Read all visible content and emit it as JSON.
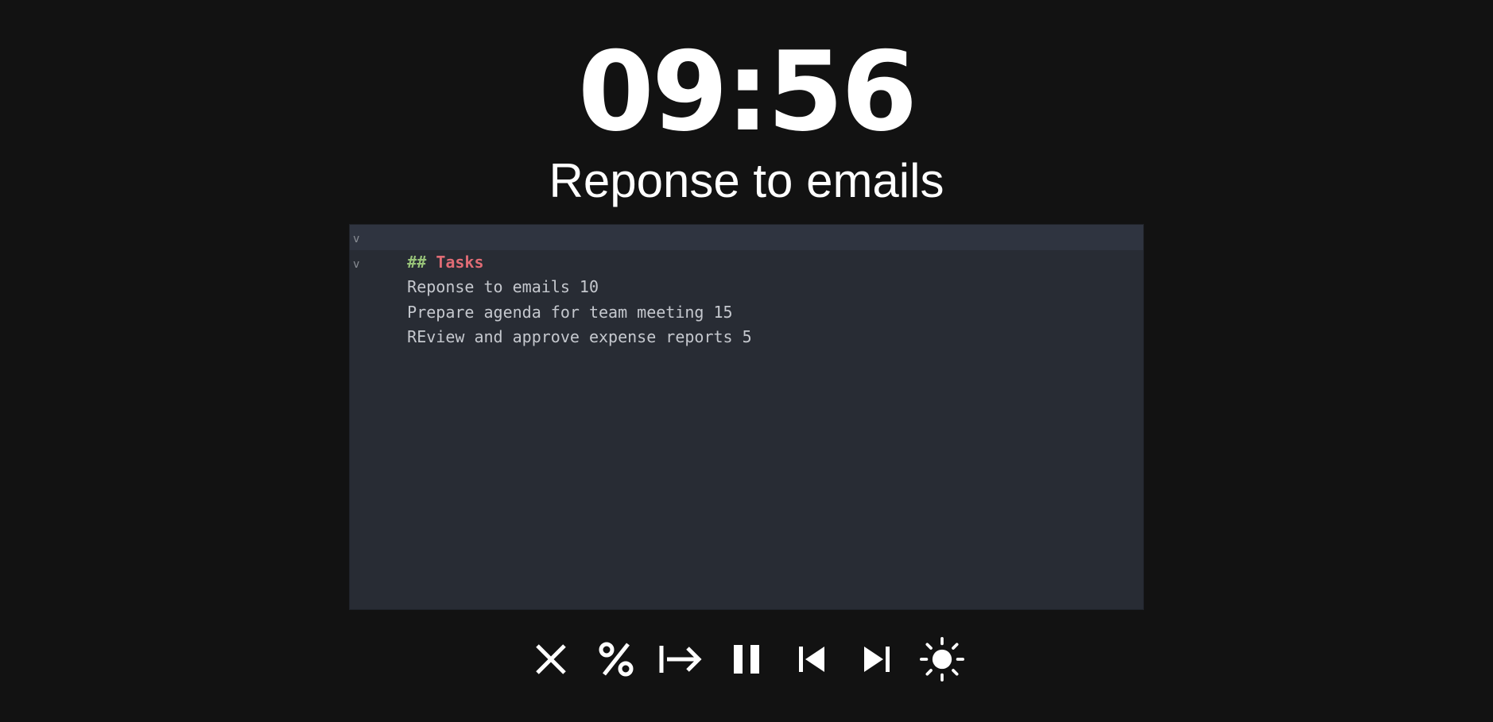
{
  "timer": {
    "display": "09:56"
  },
  "current_task": {
    "label": "Reponse to emails"
  },
  "editor": {
    "heading_marker": "##",
    "heading_text": "Tasks",
    "fold_glyph": "v",
    "lines": [
      "Reponse to emails 10",
      "Prepare agenda for team meeting 15",
      "REview and approve expense reports 5"
    ]
  },
  "controls": [
    {
      "name": "close",
      "icon": "close-icon"
    },
    {
      "name": "percent",
      "icon": "percent-icon"
    },
    {
      "name": "skip-to-end",
      "icon": "arrow-right-bar-icon"
    },
    {
      "name": "pause",
      "icon": "pause-icon"
    },
    {
      "name": "previous",
      "icon": "skip-previous-icon"
    },
    {
      "name": "next",
      "icon": "skip-next-icon"
    },
    {
      "name": "theme",
      "icon": "sun-icon"
    }
  ],
  "colors": {
    "background": "#121212",
    "editor_background": "#282c34",
    "heading_marker": "#98c379",
    "heading_text": "#e06c75",
    "editor_text": "#c5c8ce"
  }
}
